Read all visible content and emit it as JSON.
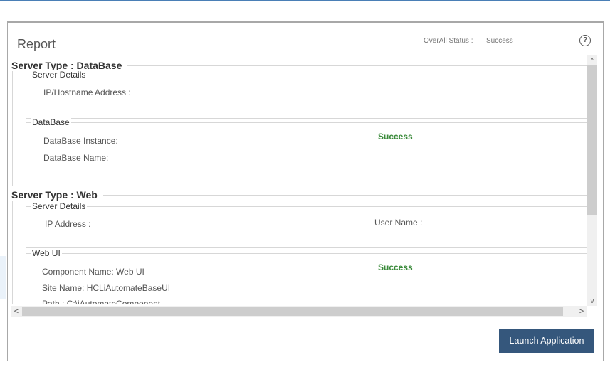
{
  "report": {
    "title": "Report",
    "overall_status_label": "OverAll Status :",
    "overall_status_value": "Success",
    "help_glyph": "?"
  },
  "database": {
    "section_title": "Server Type : DataBase",
    "server_details_title": "Server Details",
    "ip_label": "IP/Hostname Address :",
    "db_group_title": "DataBase",
    "instance_label": "DataBase Instance:",
    "name_label": "DataBase Name:",
    "status": "Success"
  },
  "web": {
    "section_title": "Server Type : Web",
    "server_details_title": "Server Details",
    "ip_label": "IP Address :",
    "user_label": "User Name :",
    "webui_group_title": "Web UI",
    "component_label": "Component Name: Web UI",
    "site_label": "Site Name: HCLiAutomateBaseUI",
    "path_label": "Path : C:\\iAutomateComponent",
    "status": "Success"
  },
  "scroll": {
    "up_glyph": "^",
    "down_glyph": "v",
    "left_glyph": "<",
    "right_glyph": ">"
  },
  "footer": {
    "launch_label": "Launch Application"
  },
  "colors": {
    "accent": "#35577c",
    "success": "#3a8a3a",
    "topbar": "#4a7fb6"
  }
}
